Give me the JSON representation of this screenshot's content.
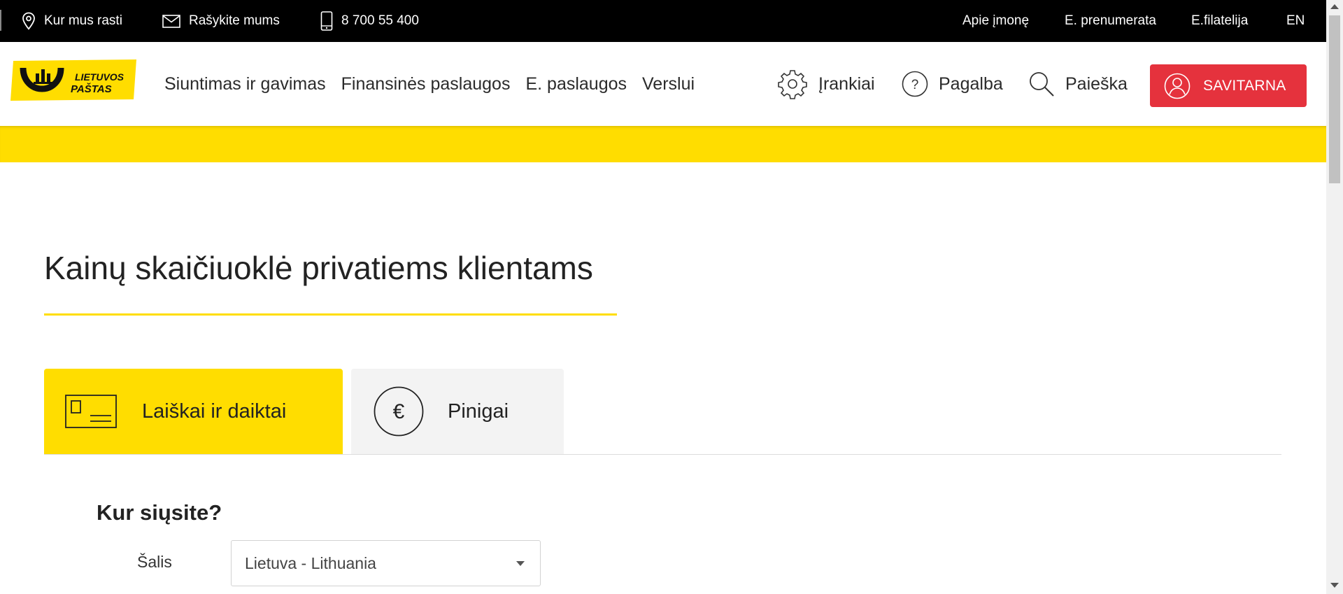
{
  "topbar": {
    "location_label": "Kur mus rasti",
    "contact_label": "Rašykite mums",
    "phone_label": "8 700 55 400",
    "about_label": "Apie įmonę",
    "subscription_label": "E. prenumerata",
    "philately_label": "E.filatelija",
    "language_label": "EN"
  },
  "header": {
    "logo_text_line1": "LIETUVOS",
    "logo_text_line2": "PAŠTAS",
    "nav": [
      {
        "label": "Siuntimas ir gavimas"
      },
      {
        "label": "Finansinės paslaugos"
      },
      {
        "label": "E. paslaugos"
      },
      {
        "label": "Verslui"
      }
    ],
    "tools_label": "Įrankiai",
    "help_label": "Pagalba",
    "search_label": "Paieška",
    "self_service_label": "SAVITARNA"
  },
  "main": {
    "title": "Kainų skaičiuoklė privatiems klientams",
    "tabs": [
      {
        "label": "Laiškai ir daiktai",
        "active": true
      },
      {
        "label": "Pinigai",
        "active": false
      }
    ],
    "section_title": "Kur siųsite?",
    "country_field": {
      "label": "Šalis",
      "value": "Lietuva - Lithuania"
    }
  },
  "colors": {
    "brand_yellow": "#ffdd00",
    "accent_red": "#e5323d",
    "topbar_black": "#000000"
  },
  "icons": [
    "location-pin-icon",
    "envelope-icon",
    "phone-icon",
    "gear-icon",
    "help-icon",
    "search-icon",
    "user-icon",
    "letter-card-icon",
    "euro-icon",
    "dropdown-caret-icon"
  ]
}
